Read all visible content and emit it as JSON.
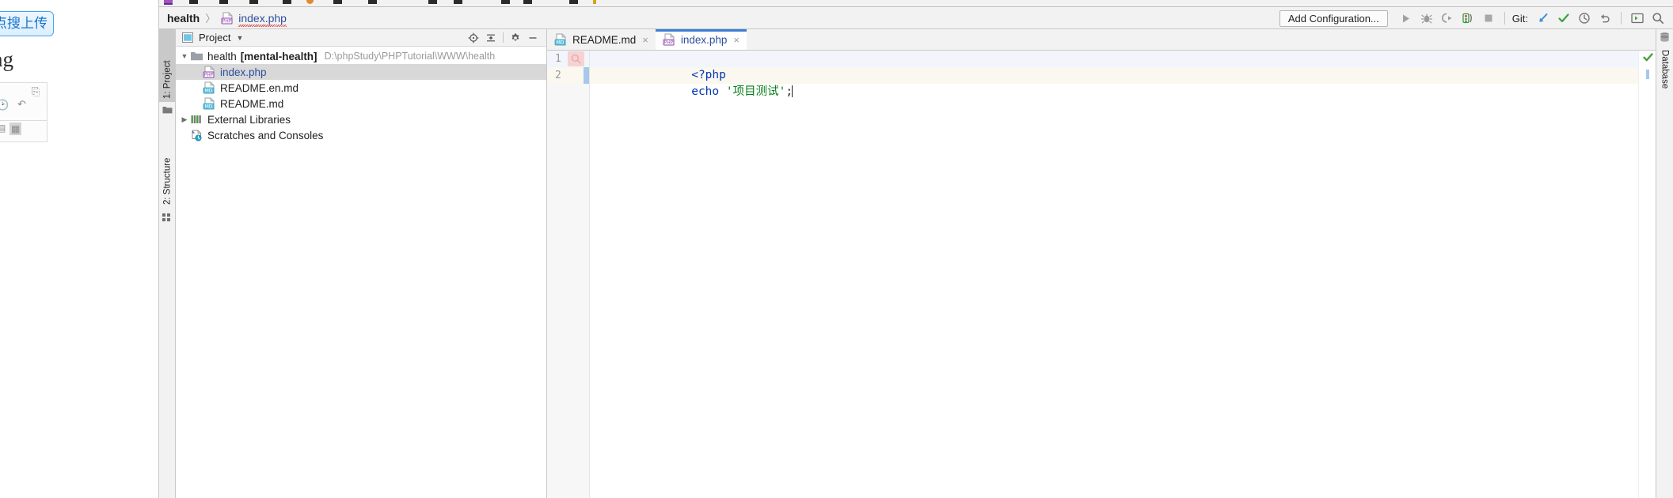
{
  "background_window": {
    "upload_button_label": "点搜上传",
    "heading_text": "ng"
  },
  "navbar": {
    "breadcrumb_root": "health",
    "breadcrumb_separator": "〉",
    "breadcrumb_file": "index.php",
    "add_configuration_label": "Add Configuration...",
    "git_label": "Git:",
    "buttons": [
      {
        "name": "run-button",
        "icon": "play-icon"
      },
      {
        "name": "debug-button",
        "icon": "bug-icon"
      },
      {
        "name": "run-with-coverage-button",
        "icon": "coverage-icon"
      },
      {
        "name": "profiler-button",
        "icon": "profiler-icon"
      },
      {
        "name": "stop-button",
        "icon": "stop-icon"
      },
      {
        "name": "git-update-project-button",
        "icon": "arrow-down-left-icon"
      },
      {
        "name": "git-commit-button",
        "icon": "checkmark-icon"
      },
      {
        "name": "git-history-button",
        "icon": "clock-icon"
      },
      {
        "name": "git-rollback-button",
        "icon": "undo-icon"
      },
      {
        "name": "terminal-button",
        "icon": "terminal-icon"
      },
      {
        "name": "search-everywhere-button",
        "icon": "search-icon"
      }
    ]
  },
  "tool_windows": {
    "left": [
      {
        "label": "1: Project",
        "active": true
      },
      {
        "label": "2: Structure",
        "active": false
      }
    ],
    "right": [
      {
        "label": "Database",
        "active": false
      }
    ]
  },
  "project_panel": {
    "title": "Project",
    "toolbar": [
      {
        "name": "locate-file-button",
        "icon": "target-icon"
      },
      {
        "name": "collapse-all-button",
        "icon": "collapse-icon"
      },
      {
        "name": "settings-button",
        "icon": "gear-icon"
      },
      {
        "name": "hide-button",
        "icon": "minus-icon"
      }
    ],
    "tree": [
      {
        "name": "health",
        "module": "[mental-health]",
        "path": "D:\\phpStudy\\PHPTutorial\\WWW\\health",
        "icon": "folder-icon",
        "indent": 0,
        "arrow": "expanded",
        "selected": false
      },
      {
        "name": "index.php",
        "module": "",
        "path": "",
        "icon": "php-file-icon",
        "indent": 1,
        "arrow": "none",
        "selected": true
      },
      {
        "name": "README.en.md",
        "module": "",
        "path": "",
        "icon": "md-file-icon",
        "indent": 1,
        "arrow": "none",
        "selected": false
      },
      {
        "name": "README.md",
        "module": "",
        "path": "",
        "icon": "md-file-icon",
        "indent": 1,
        "arrow": "none",
        "selected": false
      },
      {
        "name": "External Libraries",
        "module": "",
        "path": "",
        "icon": "library-icon",
        "indent": 0,
        "arrow": "collapsed",
        "selected": false
      },
      {
        "name": "Scratches and Consoles",
        "module": "",
        "path": "",
        "icon": "scratches-icon",
        "indent": 0,
        "arrow": "none",
        "selected": false
      }
    ]
  },
  "editor": {
    "tabs": [
      {
        "label": "README.md",
        "icon": "md-file-icon",
        "active": false
      },
      {
        "label": "index.php",
        "icon": "php-file-icon",
        "active": true
      }
    ],
    "close_glyph": "×",
    "lines": [
      {
        "number": "1",
        "text": "<?php"
      },
      {
        "number": "2",
        "text": "echo '项目测试';"
      }
    ],
    "code_tokens": {
      "line1_tag": "<?php",
      "line2_keyword": "echo",
      "line2_string": "'项目测试'",
      "line2_semicolon": ";"
    },
    "inspection_status": "ok"
  },
  "colors": {
    "accent_blue": "#3c7fd4",
    "link_blue": "#2c4f9e",
    "keyword_blue": "#0033b3",
    "string_green": "#067d17",
    "selection_gray": "#d8d8d8",
    "current_line_yellow": "#faf8ef",
    "line1_blue": "#f2f5fb",
    "change_bar_blue": "#a6c8ea",
    "ok_green": "#4a9e42"
  }
}
